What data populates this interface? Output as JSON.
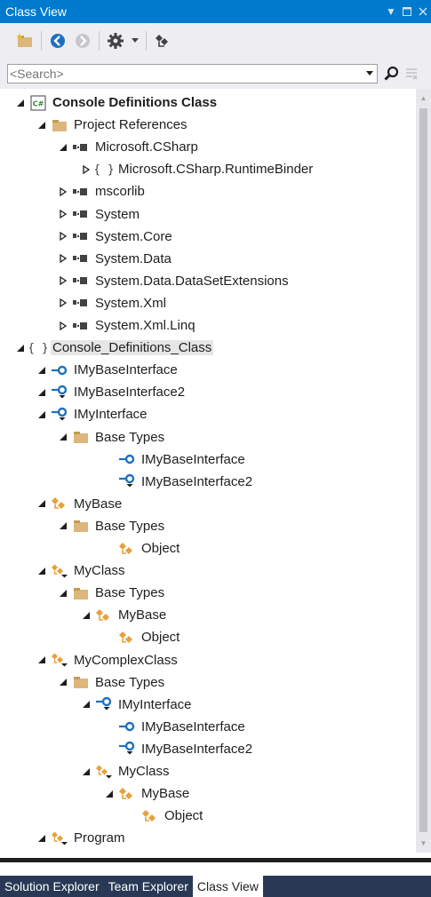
{
  "window": {
    "title": "Class View"
  },
  "search": {
    "value": "",
    "placeholder": "<Search>"
  },
  "colors": {
    "titlebar": "#007acc",
    "tabbar": "#293955",
    "folder": "#dcb67a",
    "class": "#e8a03a",
    "interface": "#1e70c0"
  },
  "tree": [
    {
      "label": "Console Definitions Class",
      "icon": "csharp-project-icon",
      "expander": "expanded",
      "bold": true
    },
    {
      "label": "Project References",
      "icon": "folder-icon",
      "expander": "expanded"
    },
    {
      "label": "Microsoft.CSharp",
      "icon": "assembly-icon",
      "expander": "expanded"
    },
    {
      "label": "Microsoft.CSharp.RuntimeBinder",
      "icon": "namespace-icon",
      "expander": "collapsed"
    },
    {
      "label": "mscorlib",
      "icon": "assembly-icon",
      "expander": "collapsed"
    },
    {
      "label": "System",
      "icon": "assembly-icon",
      "expander": "collapsed"
    },
    {
      "label": "System.Core",
      "icon": "assembly-icon",
      "expander": "collapsed"
    },
    {
      "label": "System.Data",
      "icon": "assembly-icon",
      "expander": "collapsed"
    },
    {
      "label": "System.Data.DataSetExtensions",
      "icon": "assembly-icon",
      "expander": "collapsed"
    },
    {
      "label": "System.Xml",
      "icon": "assembly-icon",
      "expander": "collapsed"
    },
    {
      "label": "System.Xml.Linq",
      "icon": "assembly-icon",
      "expander": "collapsed"
    },
    {
      "label": "Console_Definitions_Class",
      "icon": "namespace-icon",
      "expander": "expanded"
    },
    {
      "label": "IMyBaseInterface",
      "icon": "interface-icon",
      "expander": "expanded"
    },
    {
      "label": "IMyBaseInterface2",
      "icon": "interface-derived-icon",
      "expander": "expanded"
    },
    {
      "label": "IMyInterface",
      "icon": "interface-derived-icon",
      "expander": "expanded"
    },
    {
      "label": "Base Types",
      "icon": "folder-icon",
      "expander": "expanded"
    },
    {
      "label": "IMyBaseInterface",
      "icon": "interface-icon",
      "expander": "none"
    },
    {
      "label": "IMyBaseInterface2",
      "icon": "interface-derived-icon",
      "expander": "none"
    },
    {
      "label": "MyBase",
      "icon": "class-icon",
      "expander": "expanded"
    },
    {
      "label": "Base Types",
      "icon": "folder-icon",
      "expander": "expanded"
    },
    {
      "label": "Object",
      "icon": "class-icon",
      "expander": "none"
    },
    {
      "label": "MyClass",
      "icon": "class-derived-icon",
      "expander": "expanded"
    },
    {
      "label": "Base Types",
      "icon": "folder-icon",
      "expander": "expanded"
    },
    {
      "label": "MyBase",
      "icon": "class-icon",
      "expander": "expanded"
    },
    {
      "label": "Object",
      "icon": "class-icon",
      "expander": "none"
    },
    {
      "label": "MyComplexClass",
      "icon": "class-derived-icon",
      "expander": "expanded"
    },
    {
      "label": "Base Types",
      "icon": "folder-icon",
      "expander": "expanded"
    },
    {
      "label": "IMyInterface",
      "icon": "interface-derived-icon",
      "expander": "expanded"
    },
    {
      "label": "IMyBaseInterface",
      "icon": "interface-icon",
      "expander": "none"
    },
    {
      "label": "IMyBaseInterface2",
      "icon": "interface-derived-icon",
      "expander": "none"
    },
    {
      "label": "MyClass",
      "icon": "class-derived-icon",
      "expander": "expanded"
    },
    {
      "label": "MyBase",
      "icon": "class-icon",
      "expander": "expanded"
    },
    {
      "label": "Object",
      "icon": "class-icon",
      "expander": "none"
    },
    {
      "label": "Program",
      "icon": "class-derived-icon",
      "expander": "expanded"
    }
  ],
  "tabs": [
    {
      "label": "Solution Explorer",
      "active": false
    },
    {
      "label": "Team Explorer",
      "active": false
    },
    {
      "label": "Class View",
      "active": true
    }
  ]
}
